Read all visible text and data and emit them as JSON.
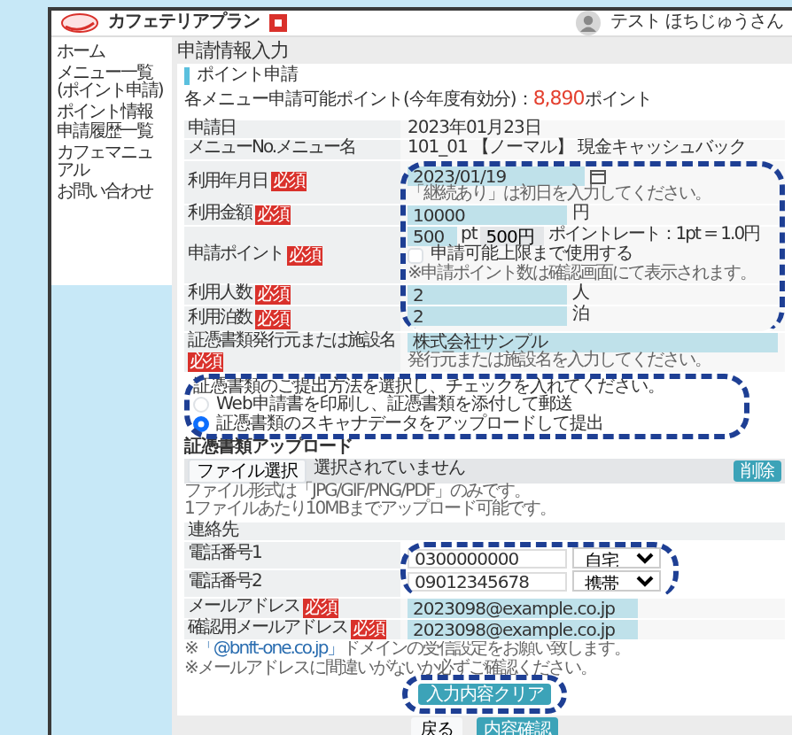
{
  "header": {
    "app_title": "カフェテリアプラン",
    "user_name": "テスト ほちじゅうさん"
  },
  "sidebar": {
    "items": [
      {
        "label": "ホーム"
      },
      {
        "label": "メニュー一覧(ポイント申請)"
      },
      {
        "label": "ポイント情報"
      },
      {
        "label": "申請履歴一覧"
      },
      {
        "label": "カフェマニュアル"
      },
      {
        "label": "お問い合わせ"
      }
    ]
  },
  "page_title": "申請情報入力",
  "section_title": "ポイント申請",
  "available_points": {
    "label": "各メニュー申請可能ポイント(今年度有効分)：",
    "value": "8,890",
    "unit": "ポイント"
  },
  "form_rows": [
    {
      "kind": "text",
      "label": "申請日",
      "value": "2023年01月23日"
    },
    {
      "kind": "text",
      "label": "メニューNo.メニュー名",
      "value": "101_01 【ノーマル】 現金キャッシュバック"
    },
    {
      "kind": "date",
      "label": "利用年月日",
      "badge": "必須",
      "value": "2023/01/19",
      "notes": [
        "「継続あり」は初日を入力してください。"
      ]
    },
    {
      "kind": "input",
      "label": "利用金額",
      "badge": "必須",
      "value": "10000",
      "unit": "円"
    },
    {
      "kind": "points",
      "label": "申請ポイント",
      "badge": "必須",
      "value": "500",
      "unit": "pt",
      "yen_value": "500円",
      "rate": "ポイントレート：1pt = 1.0円",
      "checkbox": {
        "label": "申請可能上限まで使用する",
        "checked": false
      },
      "notes": [
        "※申請ポイント数は確認画面にて表示されます。"
      ]
    },
    {
      "kind": "input",
      "label": "利用人数",
      "badge": "必須",
      "value": "2",
      "unit": "人"
    },
    {
      "kind": "input",
      "label": "利用泊数",
      "badge": "必須",
      "value": "2",
      "unit": "泊"
    },
    {
      "kind": "wide",
      "label": "証憑書類発行元または施設名",
      "badge": "必須",
      "value": "株式会社サンプル",
      "notes": [
        "発行元または施設名を入力してください。"
      ]
    }
  ],
  "submission": {
    "intro": "証憑書類のご提出方法を選択し、チェックを入れてください。",
    "options": [
      {
        "label": "Web申請書を印刷し、証憑書類を添付して郵送",
        "selected": false
      },
      {
        "label": "証憑書類のスキャナデータをアップロードして提出",
        "selected": true
      }
    ]
  },
  "upload": {
    "label": "証憑書類アップロード",
    "file_button": "ファイル選択",
    "file_status": "選択されていません",
    "delete_button": "削除",
    "notes": [
      "ファイル形式は「JPG/GIF/PNG/PDF」のみです。",
      "1ファイルあたり10MBまでアップロード可能です。"
    ]
  },
  "contact": {
    "title": "連絡先",
    "rows": [
      {
        "kind": "tel",
        "label": "電話番号1",
        "value": "0300000000",
        "type": "自宅"
      },
      {
        "kind": "tel",
        "label": "電話番号2",
        "value": "09012345678",
        "type": "携帯"
      },
      {
        "kind": "input",
        "label": "メールアドレス",
        "badge": "必須",
        "value": "2023098@example.co.jp"
      },
      {
        "kind": "input",
        "label": "確認用メールアドレス",
        "badge": "必須",
        "value": "2023098@example.co.jp"
      }
    ]
  },
  "contact_notes": [
    {
      "before": "※",
      "link": "「@bnft-one.co.jp」",
      "after": "ドメインの受信設定をお願い致します。"
    },
    {
      "before": "※メールアドレスに間違いがないか必ずご確認ください。"
    }
  ],
  "clear_button": "入力内容クリア",
  "footer_buttons": [
    {
      "kind": "plain",
      "label": "戻る"
    },
    {
      "kind": "primary",
      "label": "内容確認"
    }
  ]
}
